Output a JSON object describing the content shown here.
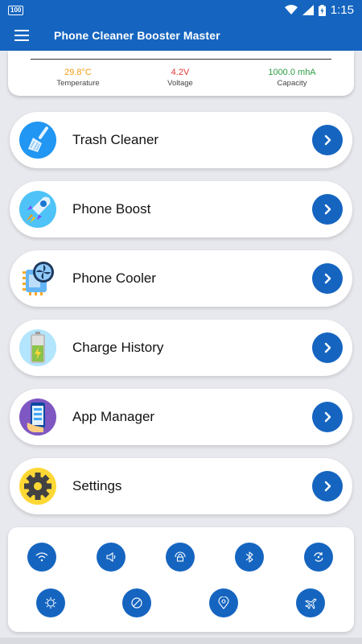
{
  "status_bar": {
    "badge": "100",
    "time": "1:15"
  },
  "app_bar": {
    "title": "Phone Cleaner Booster Master",
    "menu_icon": "hamburger-menu-icon"
  },
  "battery_info": {
    "temperature": {
      "value": "29.8°C",
      "label": "Temperature",
      "color": "#f39c12"
    },
    "voltage": {
      "value": "4.2V",
      "label": "Voltage",
      "color": "#e53935"
    },
    "capacity": {
      "value": "1000.0 mhA",
      "label": "Capacity",
      "color": "#2e9e44"
    }
  },
  "menu": [
    {
      "label": "Trash Cleaner",
      "icon": "broom-icon"
    },
    {
      "label": "Phone Boost",
      "icon": "rocket-icon"
    },
    {
      "label": "Phone Cooler",
      "icon": "cpu-fan-icon"
    },
    {
      "label": "Charge History",
      "icon": "battery-icon"
    },
    {
      "label": "App Manager",
      "icon": "phone-apps-icon"
    },
    {
      "label": "Settings",
      "icon": "gear-icon"
    }
  ],
  "quick_tools": [
    "wifi-icon",
    "volume-icon",
    "lock-rotation-icon",
    "bluetooth-icon",
    "sync-icon",
    "brightness-icon",
    "do-not-disturb-icon",
    "location-icon",
    "airplane-icon"
  ],
  "colors": {
    "primary": "#1565c0",
    "background": "#e8e9ee"
  }
}
